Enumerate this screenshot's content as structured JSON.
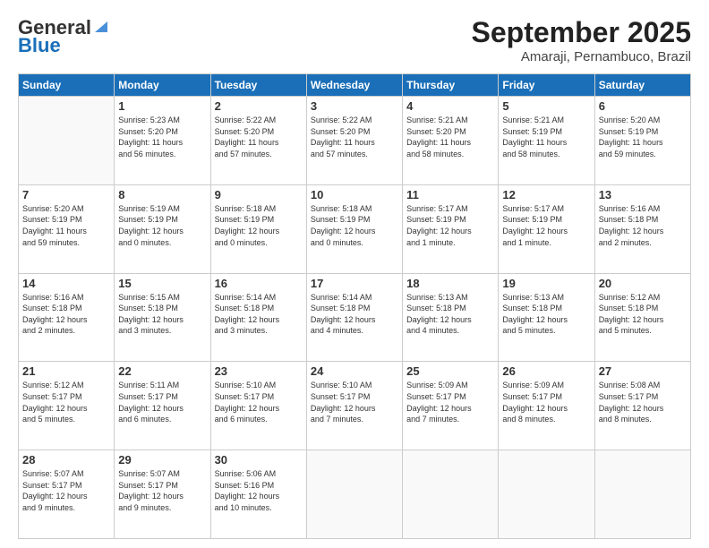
{
  "header": {
    "logo_line1": "General",
    "logo_line2": "Blue",
    "month": "September 2025",
    "location": "Amaraji, Pernambuco, Brazil"
  },
  "days_of_week": [
    "Sunday",
    "Monday",
    "Tuesday",
    "Wednesday",
    "Thursday",
    "Friday",
    "Saturday"
  ],
  "weeks": [
    [
      {
        "day": "",
        "info": ""
      },
      {
        "day": "1",
        "info": "Sunrise: 5:23 AM\nSunset: 5:20 PM\nDaylight: 11 hours\nand 56 minutes."
      },
      {
        "day": "2",
        "info": "Sunrise: 5:22 AM\nSunset: 5:20 PM\nDaylight: 11 hours\nand 57 minutes."
      },
      {
        "day": "3",
        "info": "Sunrise: 5:22 AM\nSunset: 5:20 PM\nDaylight: 11 hours\nand 57 minutes."
      },
      {
        "day": "4",
        "info": "Sunrise: 5:21 AM\nSunset: 5:20 PM\nDaylight: 11 hours\nand 58 minutes."
      },
      {
        "day": "5",
        "info": "Sunrise: 5:21 AM\nSunset: 5:19 PM\nDaylight: 11 hours\nand 58 minutes."
      },
      {
        "day": "6",
        "info": "Sunrise: 5:20 AM\nSunset: 5:19 PM\nDaylight: 11 hours\nand 59 minutes."
      }
    ],
    [
      {
        "day": "7",
        "info": "Sunrise: 5:20 AM\nSunset: 5:19 PM\nDaylight: 11 hours\nand 59 minutes."
      },
      {
        "day": "8",
        "info": "Sunrise: 5:19 AM\nSunset: 5:19 PM\nDaylight: 12 hours\nand 0 minutes."
      },
      {
        "day": "9",
        "info": "Sunrise: 5:18 AM\nSunset: 5:19 PM\nDaylight: 12 hours\nand 0 minutes."
      },
      {
        "day": "10",
        "info": "Sunrise: 5:18 AM\nSunset: 5:19 PM\nDaylight: 12 hours\nand 0 minutes."
      },
      {
        "day": "11",
        "info": "Sunrise: 5:17 AM\nSunset: 5:19 PM\nDaylight: 12 hours\nand 1 minute."
      },
      {
        "day": "12",
        "info": "Sunrise: 5:17 AM\nSunset: 5:19 PM\nDaylight: 12 hours\nand 1 minute."
      },
      {
        "day": "13",
        "info": "Sunrise: 5:16 AM\nSunset: 5:18 PM\nDaylight: 12 hours\nand 2 minutes."
      }
    ],
    [
      {
        "day": "14",
        "info": "Sunrise: 5:16 AM\nSunset: 5:18 PM\nDaylight: 12 hours\nand 2 minutes."
      },
      {
        "day": "15",
        "info": "Sunrise: 5:15 AM\nSunset: 5:18 PM\nDaylight: 12 hours\nand 3 minutes."
      },
      {
        "day": "16",
        "info": "Sunrise: 5:14 AM\nSunset: 5:18 PM\nDaylight: 12 hours\nand 3 minutes."
      },
      {
        "day": "17",
        "info": "Sunrise: 5:14 AM\nSunset: 5:18 PM\nDaylight: 12 hours\nand 4 minutes."
      },
      {
        "day": "18",
        "info": "Sunrise: 5:13 AM\nSunset: 5:18 PM\nDaylight: 12 hours\nand 4 minutes."
      },
      {
        "day": "19",
        "info": "Sunrise: 5:13 AM\nSunset: 5:18 PM\nDaylight: 12 hours\nand 5 minutes."
      },
      {
        "day": "20",
        "info": "Sunrise: 5:12 AM\nSunset: 5:18 PM\nDaylight: 12 hours\nand 5 minutes."
      }
    ],
    [
      {
        "day": "21",
        "info": "Sunrise: 5:12 AM\nSunset: 5:17 PM\nDaylight: 12 hours\nand 5 minutes."
      },
      {
        "day": "22",
        "info": "Sunrise: 5:11 AM\nSunset: 5:17 PM\nDaylight: 12 hours\nand 6 minutes."
      },
      {
        "day": "23",
        "info": "Sunrise: 5:10 AM\nSunset: 5:17 PM\nDaylight: 12 hours\nand 6 minutes."
      },
      {
        "day": "24",
        "info": "Sunrise: 5:10 AM\nSunset: 5:17 PM\nDaylight: 12 hours\nand 7 minutes."
      },
      {
        "day": "25",
        "info": "Sunrise: 5:09 AM\nSunset: 5:17 PM\nDaylight: 12 hours\nand 7 minutes."
      },
      {
        "day": "26",
        "info": "Sunrise: 5:09 AM\nSunset: 5:17 PM\nDaylight: 12 hours\nand 8 minutes."
      },
      {
        "day": "27",
        "info": "Sunrise: 5:08 AM\nSunset: 5:17 PM\nDaylight: 12 hours\nand 8 minutes."
      }
    ],
    [
      {
        "day": "28",
        "info": "Sunrise: 5:07 AM\nSunset: 5:17 PM\nDaylight: 12 hours\nand 9 minutes."
      },
      {
        "day": "29",
        "info": "Sunrise: 5:07 AM\nSunset: 5:17 PM\nDaylight: 12 hours\nand 9 minutes."
      },
      {
        "day": "30",
        "info": "Sunrise: 5:06 AM\nSunset: 5:16 PM\nDaylight: 12 hours\nand 10 minutes."
      },
      {
        "day": "",
        "info": ""
      },
      {
        "day": "",
        "info": ""
      },
      {
        "day": "",
        "info": ""
      },
      {
        "day": "",
        "info": ""
      }
    ]
  ]
}
